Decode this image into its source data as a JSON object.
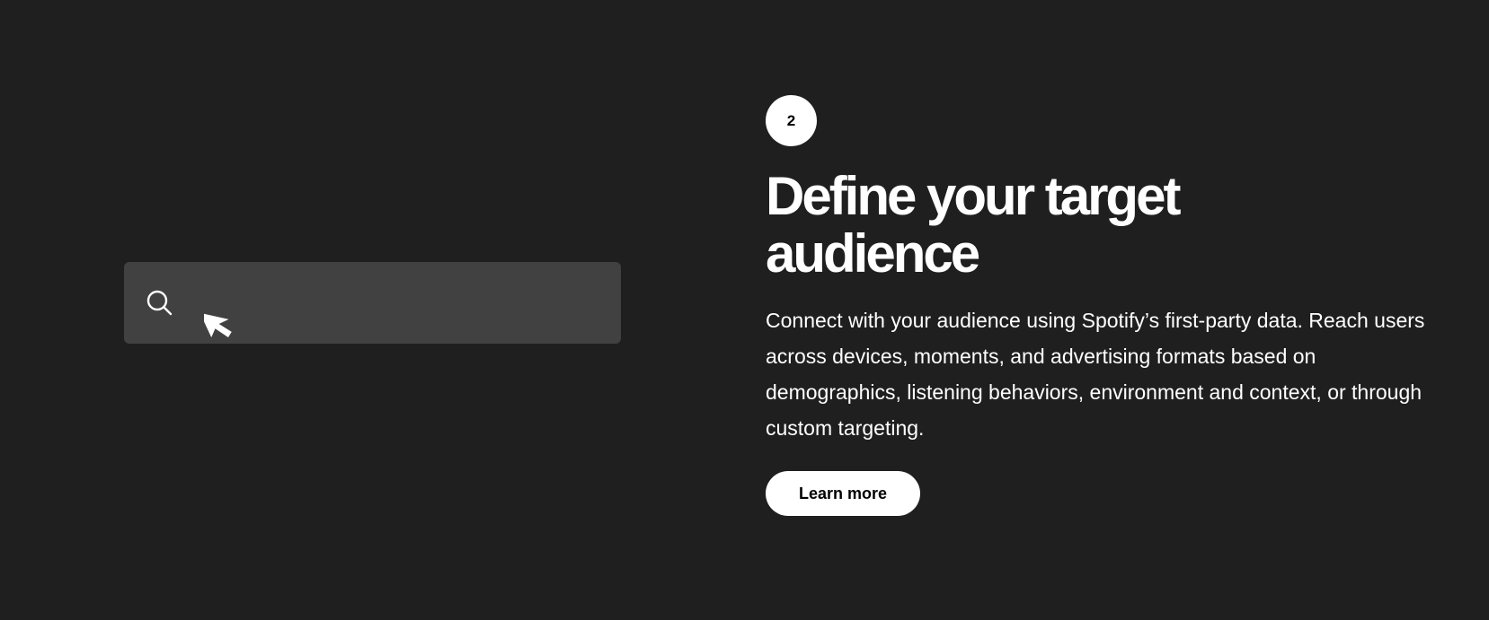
{
  "illustration": {
    "search_icon": "search-icon",
    "cursor_icon": "cursor-arrow-icon",
    "search_bar_color": "#414141"
  },
  "step": {
    "number": "2"
  },
  "section": {
    "title": "Define your target audience",
    "description": "Connect with your audience using Spotify’s first-party data. Reach users across devices, moments, and advertising formats based on demographics, listening behaviors, environment and context, or through custom targeting.",
    "cta_label": "Learn more"
  },
  "colors": {
    "background": "#1f1f1f",
    "text": "#ffffff",
    "button_bg": "#ffffff",
    "button_text": "#000000"
  }
}
